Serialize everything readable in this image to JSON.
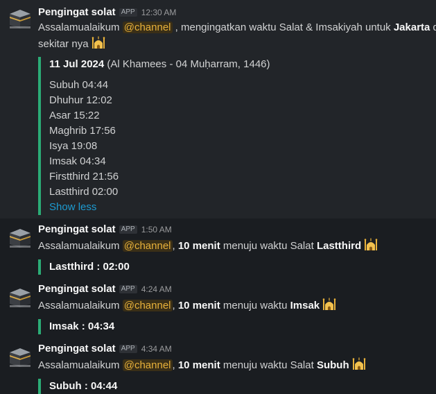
{
  "bot": {
    "name": "Pengingat solat",
    "badge": "APP"
  },
  "messages": [
    {
      "time": "12:30 AM",
      "greeting": "Assalamualaikum",
      "mention": "@channel",
      "text_a": " , mengingatkan waktu Salat & Imsakiyah untuk ",
      "city": "Jakarta",
      "text_b": " dan",
      "line2": "sekitar nya",
      "emoji_icon": "mosque-icon",
      "attachment": {
        "date": "11 Jul 2024",
        "hijri": " (Al Khamees - 04 Muḥarram, 1446)",
        "times": [
          "Subuh 04:44",
          "Dhuhur 12:02",
          "Asar 15:22",
          "Maghrib 17:56",
          "Isya 19:08",
          "Imsak 04:34",
          "Firstthird 21:56",
          "Lastthird 02:00"
        ],
        "toggle": "Show less"
      }
    },
    {
      "time": "1:50 AM",
      "greeting": "Assalamualaikum",
      "mention": "@channel",
      "sep": ", ",
      "minutes": "10 menit",
      "text": " menuju waktu Salat ",
      "target": "Lastthird",
      "attachment": "Lastthird : 02:00"
    },
    {
      "time": "4:24 AM",
      "greeting": "Assalamualaikum",
      "mention": "@channel",
      "sep": ", ",
      "minutes": "10 menit",
      "text": " menuju waktu ",
      "target": "Imsak",
      "attachment": "Imsak : 04:34"
    },
    {
      "time": "4:34 AM",
      "greeting": "Assalamualaikum",
      "mention": "@channel",
      "sep": ", ",
      "minutes": "10 menit",
      "text": " menuju waktu Salat ",
      "target": "Subuh",
      "attachment": "Subuh : 04:44"
    }
  ]
}
